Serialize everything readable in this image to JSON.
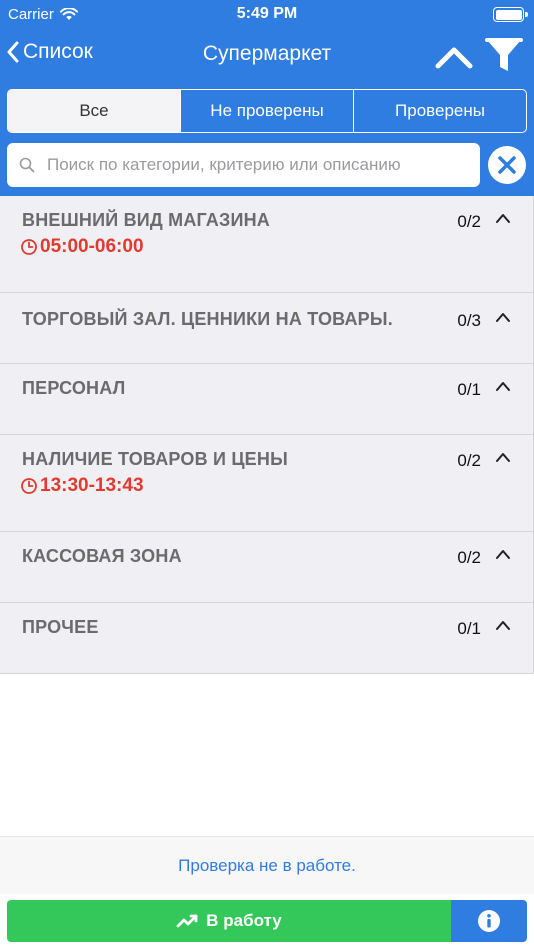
{
  "status_bar": {
    "carrier": "Carrier",
    "time": "5:49 PM"
  },
  "nav": {
    "back_label": "Список",
    "title": "Супермаркет"
  },
  "segments": [
    {
      "label": "Все",
      "active": true
    },
    {
      "label": "Не проверены",
      "active": false
    },
    {
      "label": "Проверены",
      "active": false
    }
  ],
  "search": {
    "placeholder": "Поиск по категории, критерию или описанию",
    "value": ""
  },
  "categories": [
    {
      "title": "ВНЕШНИЙ ВИД МАГАЗИНА",
      "count": "0/2",
      "time": "05:00-06:00"
    },
    {
      "title": "ТОРГОВЫЙ ЗАЛ. ЦЕННИКИ НА ТОВАРЫ.",
      "count": "0/3",
      "time": ""
    },
    {
      "title": "ПЕРСОНАЛ",
      "count": "0/1",
      "time": ""
    },
    {
      "title": "НАЛИЧИЕ ТОВАРОВ И ЦЕНЫ",
      "count": "0/2",
      "time": "13:30-13:43"
    },
    {
      "title": "КАССОВАЯ ЗОНА",
      "count": "0/2",
      "time": ""
    },
    {
      "title": "ПРОЧЕЕ",
      "count": "0/1",
      "time": ""
    }
  ],
  "footer": {
    "status_text": "Проверка не в работе.",
    "work_button_label": "В работу"
  },
  "colors": {
    "primary": "#2f7de1",
    "success": "#34c759",
    "alert": "#e23a2e",
    "row_bg": "#efeff4"
  },
  "icons": {
    "back": "chevron-left-icon",
    "collapse": "chevron-up-icon",
    "filter": "funnel-icon",
    "search": "magnifier-icon",
    "clear": "close-icon",
    "time": "clock-icon",
    "work": "trend-icon",
    "info": "info-icon"
  }
}
